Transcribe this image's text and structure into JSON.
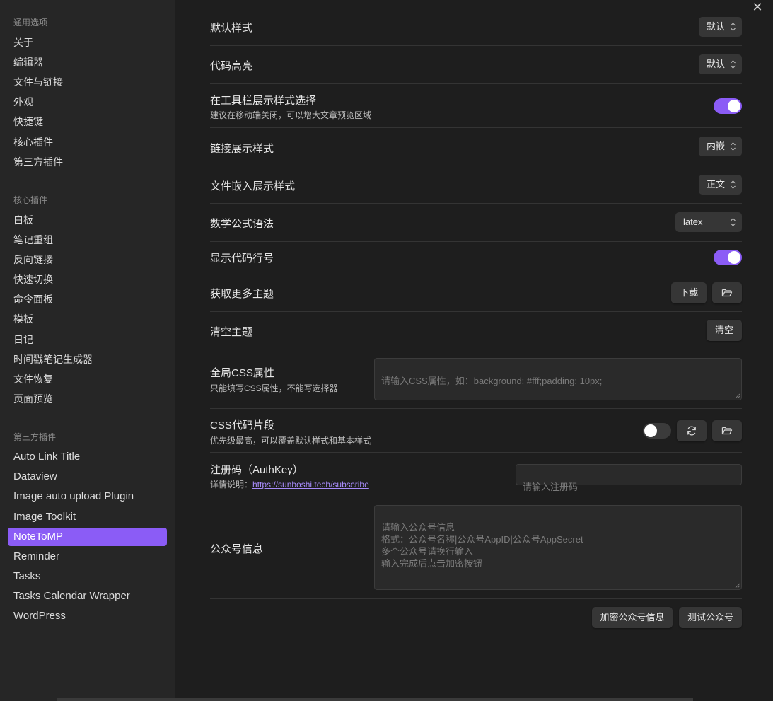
{
  "sidebar": {
    "groups": [
      {
        "title": "通用选项",
        "items": [
          "关于",
          "编辑器",
          "文件与链接",
          "外观",
          "快捷键",
          "核心插件",
          "第三方插件"
        ]
      },
      {
        "title": "核心插件",
        "items": [
          "白板",
          "笔记重组",
          "反向链接",
          "快速切换",
          "命令面板",
          "模板",
          "日记",
          "时间戳笔记生成器",
          "文件恢复",
          "页面预览"
        ]
      },
      {
        "title": "第三方插件",
        "items": [
          "Auto Link Title",
          "Dataview",
          "Image auto upload Plugin",
          "Image Toolkit",
          "NoteToMP",
          "Reminder",
          "Tasks",
          "Tasks Calendar Wrapper",
          "WordPress"
        ]
      }
    ],
    "active_item": "NoteToMP"
  },
  "settings": {
    "default_style": {
      "label": "默认样式",
      "value": "默认"
    },
    "code_highlight": {
      "label": "代码高亮",
      "value": "默认"
    },
    "toolbar_style": {
      "label": "在工具栏展示样式选择",
      "desc": "建议在移动端关闭，可以增大文章预览区域",
      "enabled": true
    },
    "link_style": {
      "label": "链接展示样式",
      "value": "内嵌"
    },
    "embed_style": {
      "label": "文件嵌入展示样式",
      "value": "正文"
    },
    "math_syntax": {
      "label": "数学公式语法",
      "value": "latex"
    },
    "line_numbers": {
      "label": "显示代码行号",
      "enabled": true
    },
    "more_themes": {
      "label": "获取更多主题",
      "download_label": "下载"
    },
    "clear_themes": {
      "label": "清空主题",
      "clear_label": "清空"
    },
    "global_css": {
      "label": "全局CSS属性",
      "desc": "只能填写CSS属性，不能写选择器",
      "placeholder": "请输入CSS属性，如：background: #fff;padding: 10px;"
    },
    "css_snippet": {
      "label": "CSS代码片段",
      "desc": "优先级最高，可以覆盖默认样式和基本样式",
      "enabled": false
    },
    "auth_key": {
      "label": "注册码（AuthKey）",
      "desc_prefix": "详情说明：",
      "link": "https://sunboshi.tech/subscribe",
      "placeholder": "请输入注册码"
    },
    "wechat_info": {
      "label": "公众号信息",
      "placeholder": "请输入公众号信息\n格式：公众号名称|公众号AppID|公众号AppSecret\n多个公众号请换行输入\n输入完成后点击加密按钮"
    },
    "encrypt_button": "加密公众号信息",
    "test_button": "测试公众号"
  },
  "close_label": "✕",
  "colors": {
    "accent": "#8b5cf6",
    "background": "#1e1e1e",
    "sidebar": "#262626"
  }
}
